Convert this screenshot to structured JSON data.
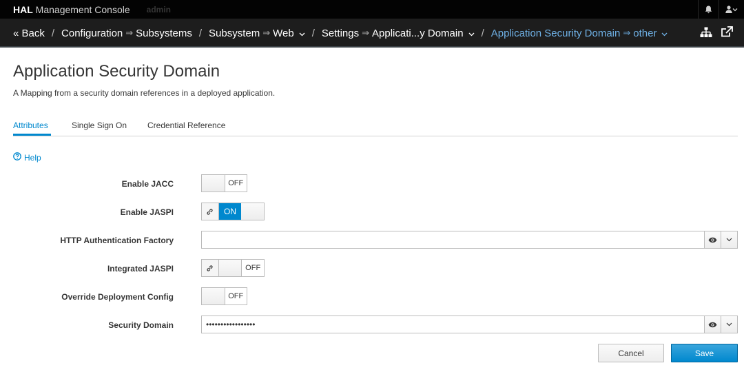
{
  "topbar": {
    "brand_bold": "HAL",
    "brand_rest": " Management Console",
    "user": "admin",
    "icons": [
      "bell-icon",
      "user-icon",
      "chevron-down-icon"
    ]
  },
  "breadcrumb": {
    "back": "« Back",
    "items": [
      {
        "parent": "Configuration",
        "child": "Subsystems",
        "dropdown": false
      },
      {
        "parent": "Subsystem",
        "child": "Web",
        "dropdown": true
      },
      {
        "parent": "Settings",
        "child": "Applicati...y Domain",
        "dropdown": true
      },
      {
        "parent": "Application Security Domain",
        "child": "other",
        "dropdown": true
      }
    ],
    "sep": "/",
    "arrow": "⇒"
  },
  "page": {
    "title": "Application Security Domain",
    "description": "A Mapping from a security domain references in a deployed application."
  },
  "tabs": [
    {
      "label": "Attributes",
      "active": true
    },
    {
      "label": "Single Sign On",
      "active": false
    },
    {
      "label": "Credential Reference",
      "active": false
    }
  ],
  "help": "Help",
  "form": {
    "enable_jacc": {
      "label": "Enable JACC",
      "state": "OFF"
    },
    "enable_jaspi": {
      "label": "Enable JASPI",
      "state": "ON"
    },
    "http_auth_factory": {
      "label": "HTTP Authentication Factory",
      "value": ""
    },
    "integrated_jaspi": {
      "label": "Integrated JASPI",
      "state": "OFF"
    },
    "override_deployment_config": {
      "label": "Override Deployment Config",
      "state": "OFF"
    },
    "security_domain": {
      "label": "Security Domain",
      "value": "•••••••••••••••••"
    }
  },
  "buttons": {
    "cancel": "Cancel",
    "save": "Save"
  },
  "colors": {
    "accent": "#0088ce",
    "topbar": "#030303",
    "crumbbar": "#1d1d1d",
    "active_crumb": "#6fb1e6"
  }
}
